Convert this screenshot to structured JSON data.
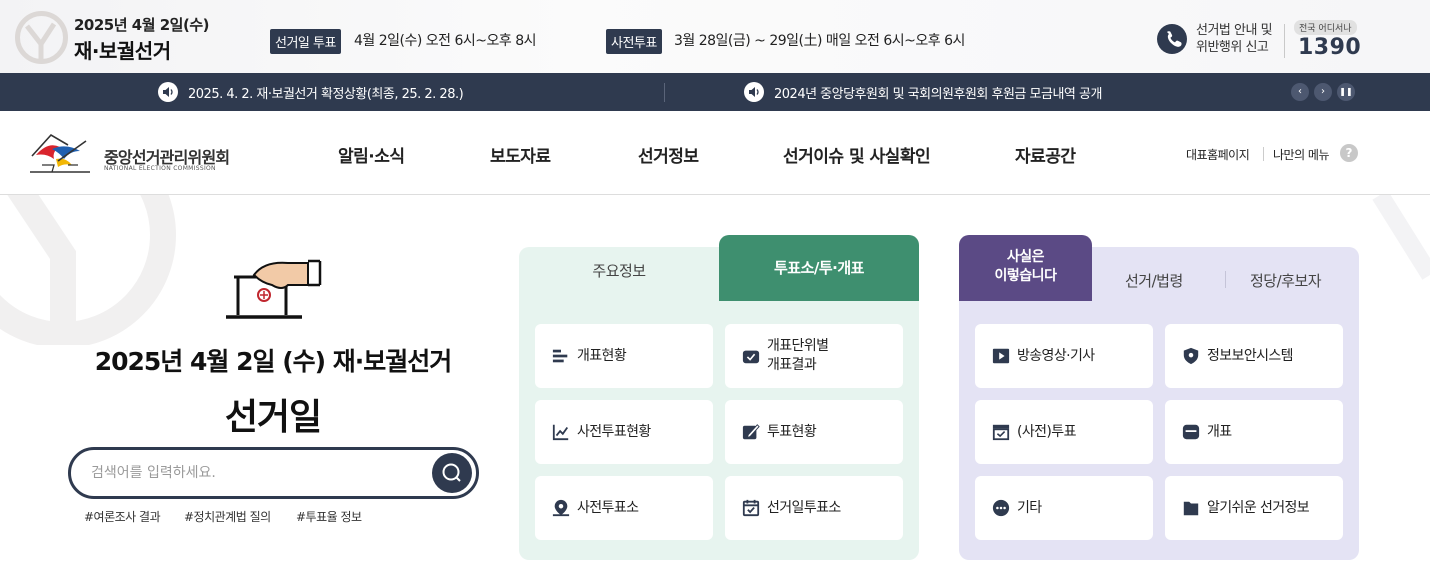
{
  "election_banner": {
    "date_line": "2025년 4월 2일(수)",
    "title": "재·보궐선거",
    "election_day": {
      "tag": "선거일 투표",
      "text": "4월 2일(수) 오전 6시~오후 8시"
    },
    "early_vote": {
      "tag": "사전투표",
      "text": "3월 28일(금) ~ 29일(土) 매일 오전 6시~오후 6시"
    },
    "hotline": {
      "desc_line1": "선거법 안내 및",
      "desc_line2": "위반행위 신고",
      "badge": "전국 어디서나",
      "number": "1390"
    }
  },
  "notices": {
    "items": [
      "2025. 4. 2. 재·보궐선거 확정상황(최종, 25. 2. 28.)",
      "2024년 중앙당후원회 및 국회의원후원회 후원금 모금내역 공개"
    ],
    "controls": [
      "prev",
      "next",
      "pause"
    ]
  },
  "header": {
    "org_name": "중앙선거관리위원회",
    "org_name_en": "NATIONAL ELECTION COMMISSION",
    "menu": [
      "알림·소식",
      "보도자료",
      "선거정보",
      "선거이슈 및 사실확인",
      "자료공간"
    ],
    "utility": [
      "대표홈페이지",
      "나만의 메뉴"
    ],
    "help": "?"
  },
  "hero": {
    "title": "2025년 4월 2일 (수) 재·보궐선거",
    "subtitle": "선거일",
    "search": {
      "placeholder": "검색어를 입력하세요.",
      "value": ""
    },
    "tags": [
      "#여론조사 결과",
      "#정치관계법 질의",
      "#투표율 정보"
    ]
  },
  "panel_election": {
    "tabs": [
      {
        "label": "주요정보",
        "active": false
      },
      {
        "label": "투표소/투·개표",
        "active": true
      }
    ],
    "items": [
      {
        "label": "개표현황",
        "icon": "bar-list-icon"
      },
      {
        "label_line1": "개표단위별",
        "label_line2": "개표결과",
        "icon": "ballot-box-icon"
      },
      {
        "label": "사전투표현황",
        "icon": "trend-chart-icon"
      },
      {
        "label": "투표현황",
        "icon": "edit-check-icon"
      },
      {
        "label": "사전투표소",
        "icon": "location-pin-icon"
      },
      {
        "label": "선거일투표소",
        "icon": "calendar-check-icon"
      }
    ],
    "colors": {
      "background": "#e7f4ef",
      "accent": "#3e8f6f"
    }
  },
  "panel_facts": {
    "tabs": [
      {
        "label_line1": "사실은",
        "label_line2": "이렇습니다",
        "active": true
      },
      {
        "label": "선거/법령",
        "active": false
      },
      {
        "label": "정당/후보자",
        "active": false
      }
    ],
    "items": [
      {
        "label": "방송영상·기사",
        "icon": "play-icon"
      },
      {
        "label": "정보보안시스템",
        "icon": "shield-icon"
      },
      {
        "label": "(사전)투표",
        "icon": "ballot-box-icon"
      },
      {
        "label": "개표",
        "icon": "counting-box-icon"
      },
      {
        "label": "기타",
        "icon": "more-dots-icon"
      },
      {
        "label": "알기쉬운 선거정보",
        "icon": "folder-icon"
      }
    ],
    "colors": {
      "background": "#e4e3f4",
      "accent": "#5b4a85"
    }
  },
  "colors": {
    "navy": "#2f3a4f"
  }
}
